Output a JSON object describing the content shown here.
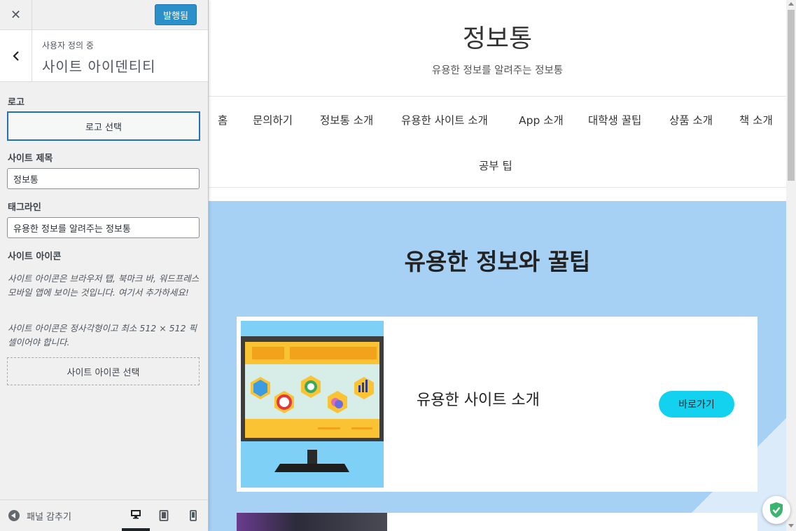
{
  "panel": {
    "publish_label": "발행됨",
    "section_sub": "사용자 정의 중",
    "section_title": "사이트 아이덴티티",
    "logo": {
      "label": "로고",
      "button": "로고 선택"
    },
    "site_title": {
      "label": "사이트 제목",
      "value": "정보통"
    },
    "tagline": {
      "label": "태그라인",
      "value": "유용한 정보를 알려주는 정보통"
    },
    "site_icon": {
      "label": "사이트 아이콘",
      "desc1": "사이트 아이콘은 브라우저 탭, 북마크 바, 워드프레스 모바일 앱에 보이는 것입니다. 여기서 추가하세요!",
      "desc2": "사이트 아이콘은 정사각형이고 최소 512 × 512 픽셀이어야 합니다.",
      "button": "사이트 아이콘 선택"
    },
    "footer": {
      "collapse_label": "패널 감추기",
      "active_device": "desktop"
    }
  },
  "preview": {
    "site_title": "정보통",
    "tagline": "유용한 정보를 알려주는 정보통",
    "nav": [
      "홈",
      "문의하기",
      "정보통 소개",
      "유용한 사이트 소개",
      "App 소개",
      "대학생 꿀팁",
      "상품 소개",
      "책 소개",
      "공부 팁"
    ],
    "hero_title": "유용한 정보와 꿀팁",
    "card": {
      "title": "유용한 사이트 소개",
      "button": "바로가기"
    }
  },
  "colors": {
    "publish": "#2b8fc9",
    "hero_bg": "#a6d0f4",
    "card_button": "#13d2ef",
    "focus": "#2271b1"
  }
}
